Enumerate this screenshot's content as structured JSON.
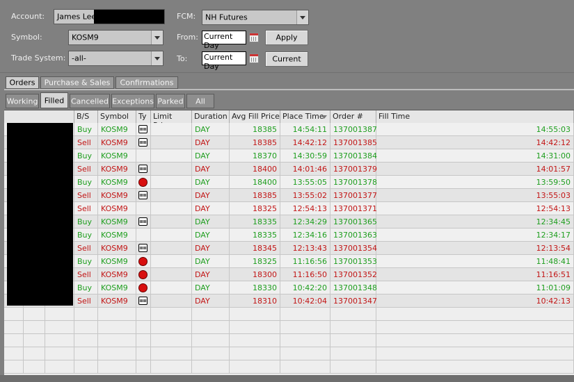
{
  "form": {
    "account_label": "Account:",
    "account_value": "James Lee",
    "fcm_label": "FCM:",
    "fcm_value": "NH Futures",
    "symbol_label": "Symbol:",
    "symbol_value": "KOSM9",
    "from_label": "From:",
    "from_value": "Current Day",
    "apply_label": "Apply",
    "trade_system_label": "Trade System:",
    "trade_system_value": "-all-",
    "to_label": "To:",
    "to_value": "Current Day",
    "current_label": "Current"
  },
  "tabs": [
    {
      "label": "Orders"
    },
    {
      "label": "Purchase & Sales"
    },
    {
      "label": "Confirmations"
    }
  ],
  "subtabs": [
    {
      "label": "Working"
    },
    {
      "label": "Filled"
    },
    {
      "label": "Cancelled"
    },
    {
      "label": "Exceptions"
    },
    {
      "label": "Parked"
    },
    {
      "label": "All"
    }
  ],
  "columns": {
    "bs": "B/S",
    "symbol": "Symbol",
    "type": "Ty",
    "limit_price": "Limit Price",
    "duration": "Duration",
    "avg_fill_price": "Avg Fill Price",
    "place_time": "Place Time",
    "order_no": "Order #",
    "fill_time": "Fill Time"
  },
  "orders": [
    {
      "side": "Buy",
      "symbol": "KOSM9",
      "type_icon": "limit-icon",
      "duration": "DAY",
      "avg_fill": "18385",
      "place_time": "14:54:11",
      "order_no": "137001387",
      "fill_time": "14:55:03"
    },
    {
      "side": "Sell",
      "symbol": "KOSM9",
      "type_icon": "limit-icon",
      "duration": "DAY",
      "avg_fill": "18385",
      "place_time": "14:42:12",
      "order_no": "137001385",
      "fill_time": "14:42:12"
    },
    {
      "side": "Buy",
      "symbol": "KOSM9",
      "type_icon": "",
      "duration": "DAY",
      "avg_fill": "18370",
      "place_time": "14:30:59",
      "order_no": "137001384",
      "fill_time": "14:31:00"
    },
    {
      "side": "Sell",
      "symbol": "KOSM9",
      "type_icon": "limit-icon",
      "duration": "DAY",
      "avg_fill": "18400",
      "place_time": "14:01:46",
      "order_no": "137001379",
      "fill_time": "14:01:57"
    },
    {
      "side": "Buy",
      "symbol": "KOSM9",
      "type_icon": "stop-icon",
      "duration": "DAY",
      "avg_fill": "18400",
      "place_time": "13:55:05",
      "order_no": "137001378",
      "fill_time": "13:59:50"
    },
    {
      "side": "Sell",
      "symbol": "KOSM9",
      "type_icon": "limit-icon",
      "duration": "DAY",
      "avg_fill": "18385",
      "place_time": "13:55:02",
      "order_no": "137001377",
      "fill_time": "13:55:03"
    },
    {
      "side": "Sell",
      "symbol": "KOSM9",
      "type_icon": "",
      "duration": "DAY",
      "avg_fill": "18325",
      "place_time": "12:54:13",
      "order_no": "137001371",
      "fill_time": "12:54:13"
    },
    {
      "side": "Buy",
      "symbol": "KOSM9",
      "type_icon": "limit-icon",
      "duration": "DAY",
      "avg_fill": "18335",
      "place_time": "12:34:29",
      "order_no": "137001365",
      "fill_time": "12:34:45"
    },
    {
      "side": "Buy",
      "symbol": "KOSM9",
      "type_icon": "",
      "duration": "DAY",
      "avg_fill": "18335",
      "place_time": "12:34:16",
      "order_no": "137001363",
      "fill_time": "12:34:17"
    },
    {
      "side": "Sell",
      "symbol": "KOSM9",
      "type_icon": "limit-icon",
      "duration": "DAY",
      "avg_fill": "18345",
      "place_time": "12:13:43",
      "order_no": "137001354",
      "fill_time": "12:13:54"
    },
    {
      "side": "Buy",
      "symbol": "KOSM9",
      "type_icon": "stop-icon",
      "duration": "DAY",
      "avg_fill": "18325",
      "place_time": "11:16:56",
      "order_no": "137001353",
      "fill_time": "11:48:41"
    },
    {
      "side": "Sell",
      "symbol": "KOSM9",
      "type_icon": "stop-icon",
      "duration": "DAY",
      "avg_fill": "18300",
      "place_time": "11:16:50",
      "order_no": "137001352",
      "fill_time": "11:16:51"
    },
    {
      "side": "Buy",
      "symbol": "KOSM9",
      "type_icon": "stop-icon",
      "duration": "DAY",
      "avg_fill": "18330",
      "place_time": "10:42:20",
      "order_no": "137001348",
      "fill_time": "11:01:09"
    },
    {
      "side": "Sell",
      "symbol": "KOSM9",
      "type_icon": "limit-icon",
      "duration": "DAY",
      "avg_fill": "18310",
      "place_time": "10:42:04",
      "order_no": "137001347",
      "fill_time": "10:42:13"
    }
  ],
  "colors": {
    "buy": "#1e9e1e",
    "sell": "#c21515",
    "background": "#808080"
  }
}
